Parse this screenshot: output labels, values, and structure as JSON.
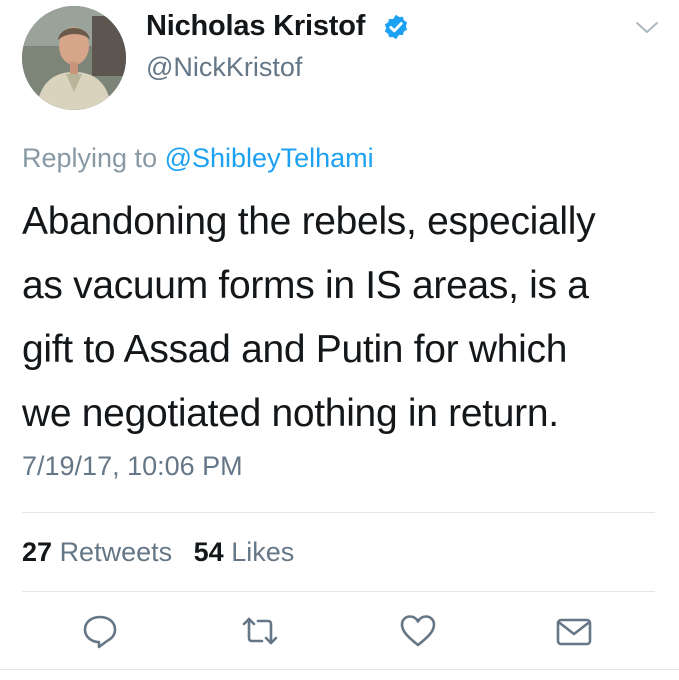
{
  "author": {
    "display_name": "Nicholas Kristof",
    "handle": "@NickKristof",
    "verified": true,
    "avatar_icon": "profile-photo"
  },
  "reply": {
    "prefix": "Replying to",
    "mention": "@ShibleyTelhami"
  },
  "tweet": {
    "lines": [
      "Abandoning the rebels, especially",
      "as vacuum forms in IS areas, is a",
      "gift to Assad and Putin for which",
      "we negotiated nothing in return."
    ],
    "timestamp": "7/19/17, 10:06 PM"
  },
  "stats": {
    "retweets_count": "27",
    "retweets_label": "Retweets",
    "likes_count": "54",
    "likes_label": "Likes"
  },
  "actions": [
    "reply-icon",
    "retweet-icon",
    "like-icon",
    "message-icon"
  ],
  "colors": {
    "text": "#14171a",
    "secondary": "#657786",
    "muted": "#8899a6",
    "accent": "#1da1f2",
    "divider": "#e1e8ed"
  }
}
